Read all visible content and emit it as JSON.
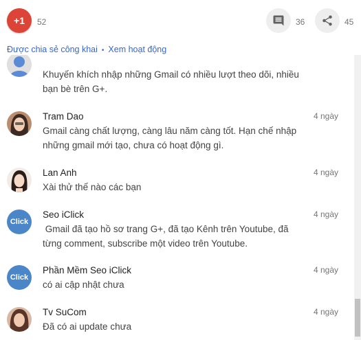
{
  "toolbar": {
    "plus_one_label": "+1",
    "plus_one_count": "52",
    "comment_icon": "comment-icon",
    "comment_count": "36",
    "share_icon": "share-icon",
    "share_count": "45",
    "colors": {
      "plus_one": "#db4437",
      "link": "#3367d6"
    }
  },
  "meta": {
    "shared_publicly": "Được chia sẻ công khai",
    "separator": "•",
    "view_activity": "Xem hoạt động"
  },
  "comments": [
    {
      "name": "",
      "time": "",
      "text": "Khuyến khích nhập những Gmail có nhiều lượt theo dõi, nhiều bạn bè trên G+."
    },
    {
      "name": "Tram Dao",
      "time": "4 ngày",
      "text": "Gmail càng chất lượng, càng lâu năm càng tốt. Hạn chế nhập những gmail mới tạo, chưa có hoạt động gì."
    },
    {
      "name": "Lan Anh",
      "time": "4 ngày",
      "text": "Xài thử thế nào các bạn"
    },
    {
      "name": "Seo iClick",
      "time": "4 ngày",
      "text": " Gmail đã tạo hồ sơ trang G+, đã tạo Kênh trên Youtube, đã từng comment, subscribe một video trên Youtube.",
      "avatar_text": "Click"
    },
    {
      "name": "Phần Mềm Seo iClick",
      "time": "4 ngày",
      "text": "có ai cập nhật chưa",
      "avatar_text": "Click"
    },
    {
      "name": "Tv SuCom",
      "time": "4 ngày",
      "text": "Đã có ai update chưa"
    }
  ]
}
